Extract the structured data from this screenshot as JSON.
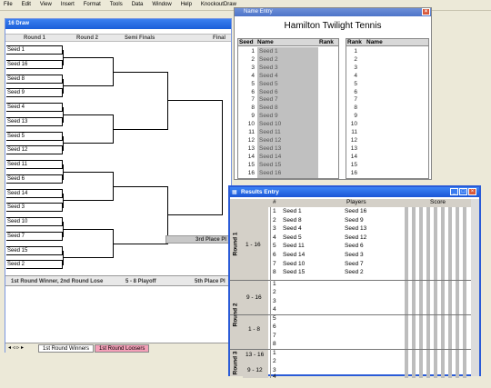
{
  "menu": [
    "File",
    "Edit",
    "View",
    "Insert",
    "Format",
    "Tools",
    "Data",
    "Window",
    "Help",
    "KnockoutDraw"
  ],
  "draw": {
    "title": "16 Draw",
    "rounds": [
      "Round 1",
      "Round 2",
      "Semi Finals",
      "Final"
    ],
    "seeds": [
      "Seed 1",
      "Seed 16",
      "Seed 8",
      "Seed 9",
      "Seed 4",
      "Seed 13",
      "Seed 5",
      "Seed 12",
      "Seed 11",
      "Seed 6",
      "Seed 14",
      "Seed 3",
      "Seed 10",
      "Seed 7",
      "Seed 15",
      "Seed 2"
    ],
    "third_place": "3rd Place Pl",
    "bottom": {
      "col1": "1st Round Winner, 2nd Round Lose",
      "col2": "5 - 8 Playoff",
      "col3": "5th Place Pl"
    },
    "tabs": [
      "1st Round Winners",
      "1st Round Loosers"
    ]
  },
  "name_entry": {
    "window_title": "Name Entry",
    "tournament": "Hamilton Twilight Tennis",
    "left_headers": {
      "seed": "Seed",
      "name": "Name",
      "rank": "Rank"
    },
    "right_headers": {
      "rank": "Rank",
      "name": "Name"
    },
    "rows": [
      "Seed 1",
      "Seed 2",
      "Seed 3",
      "Seed 4",
      "Seed 5",
      "Seed 6",
      "Seed 7",
      "Seed 8",
      "Seed 9",
      "Seed 10",
      "Seed 11",
      "Seed 12",
      "Seed 13",
      "Seed 14",
      "Seed 15",
      "Seed 16"
    ],
    "nums": [
      "1",
      "2",
      "3",
      "4",
      "5",
      "6",
      "7",
      "8",
      "9",
      "10",
      "11",
      "12",
      "13",
      "14",
      "15",
      "16"
    ]
  },
  "results": {
    "window_title": "Results Entry",
    "headers": {
      "num": "#",
      "players": "Players",
      "score": "Score"
    },
    "round1_label": "Round 1",
    "round1_range": "1 - 16",
    "round1": [
      {
        "n": "1",
        "a": "Seed 1",
        "b": "Seed 16"
      },
      {
        "n": "2",
        "a": "Seed 8",
        "b": "Seed 9"
      },
      {
        "n": "3",
        "a": "Seed 4",
        "b": "Seed 13"
      },
      {
        "n": "4",
        "a": "Seed 5",
        "b": "Seed 12"
      },
      {
        "n": "5",
        "a": "Seed 11",
        "b": "Seed 6"
      },
      {
        "n": "6",
        "a": "Seed 14",
        "b": "Seed 3"
      },
      {
        "n": "7",
        "a": "Seed 10",
        "b": "Seed 7"
      },
      {
        "n": "8",
        "a": "Seed 15",
        "b": "Seed 2"
      }
    ],
    "round2_label": "Round 2",
    "r2a_range": "9 - 16",
    "r2b_range": "1 - 8",
    "r2a_nums": [
      "1",
      "2",
      "3",
      "4"
    ],
    "r2b_nums": [
      "5",
      "6",
      "7",
      "8"
    ],
    "round3_label": "Round 3",
    "r3a_range": "13 - 16",
    "r3b_range": "9 - 12",
    "r3a_nums": [
      "1",
      "2"
    ],
    "r3b_nums": [
      "3",
      "4"
    ]
  }
}
